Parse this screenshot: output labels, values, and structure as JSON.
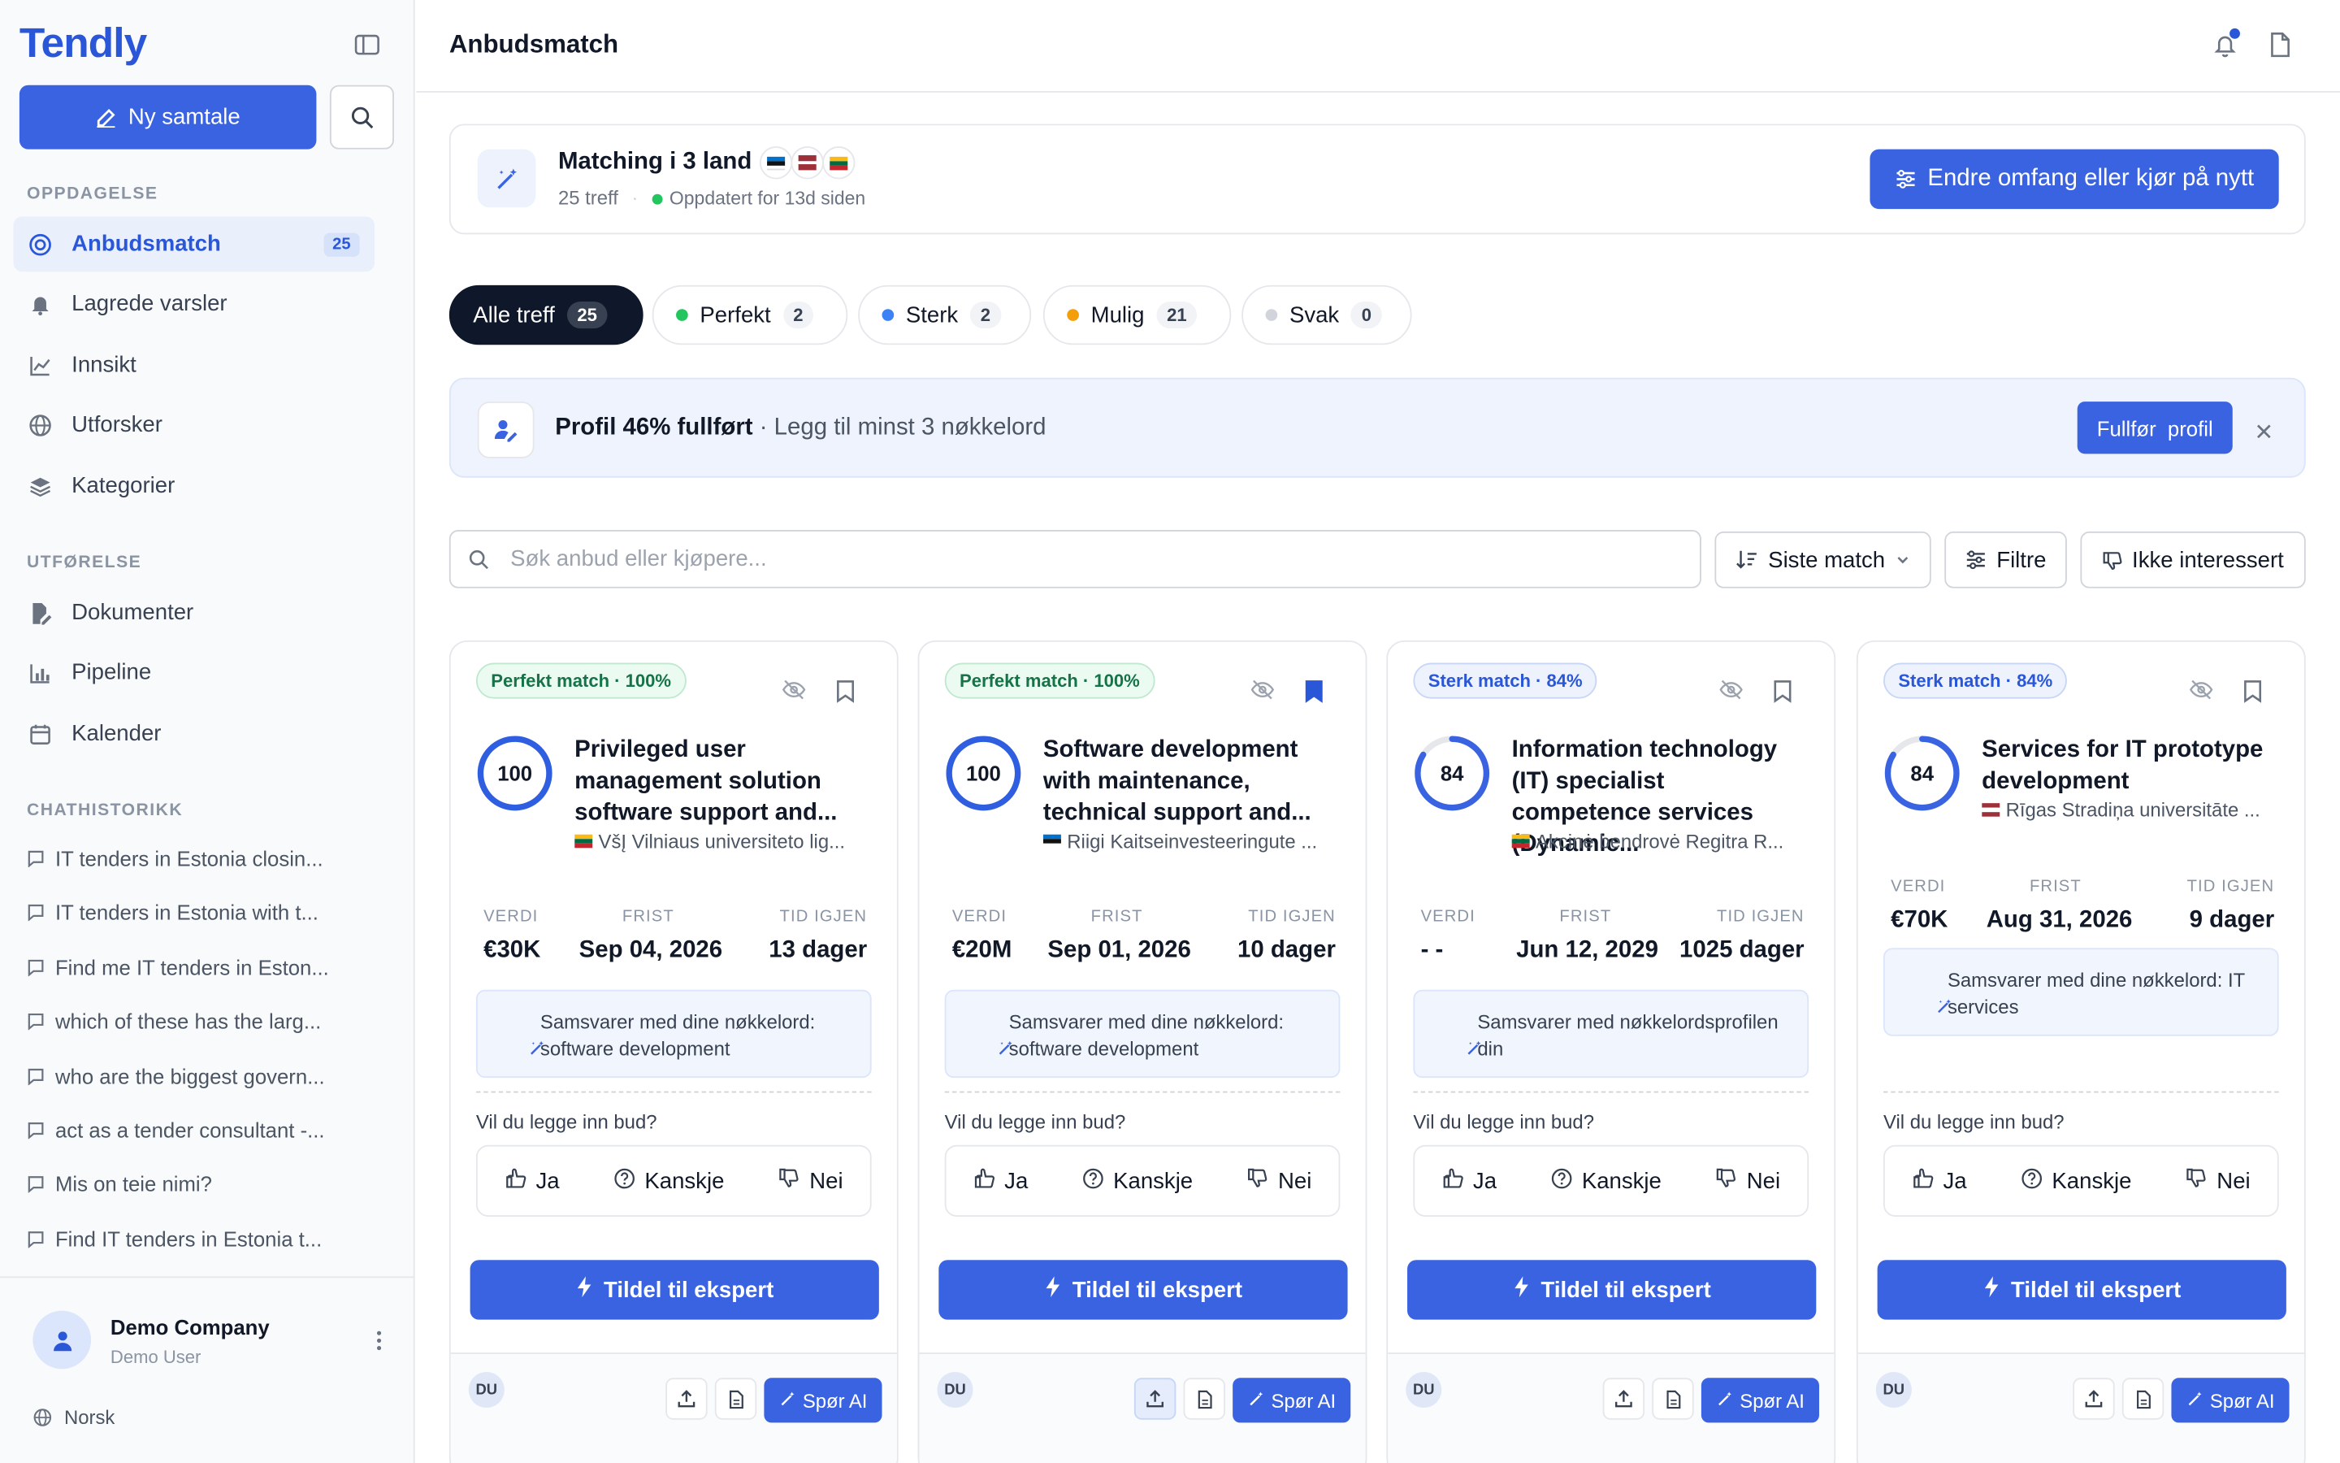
{
  "app": {
    "logo": "Tendly",
    "new_chat": "Ny samtale"
  },
  "sidebar": {
    "sections": {
      "discovery": "OPPDAGELSE",
      "execution": "UTFØRELSE",
      "history": "CHATHISTORIKK"
    },
    "discovery": [
      {
        "label": "Anbudsmatch",
        "icon": "target-icon",
        "count": "25",
        "active": true
      },
      {
        "label": "Lagrede varsler",
        "icon": "bell-icon"
      },
      {
        "label": "Innsikt",
        "icon": "line-chart-icon"
      },
      {
        "label": "Utforsker",
        "icon": "globe-icon"
      },
      {
        "label": "Kategorier",
        "icon": "layers-icon"
      }
    ],
    "execution": [
      {
        "label": "Dokumenter",
        "icon": "document-edit-icon"
      },
      {
        "label": "Pipeline",
        "icon": "bar-chart-icon"
      },
      {
        "label": "Kalender",
        "icon": "calendar-icon"
      }
    ],
    "history": [
      "IT tenders in Estonia closin...",
      "IT tenders in Estonia with t...",
      "Find me IT tenders in Eston...",
      "which of these has the larg...",
      "who are the biggest govern...",
      "act as a tender consultant -...",
      "Mis on teie nimi?",
      "Find IT tenders in Estonia t..."
    ],
    "user": {
      "company": "Demo Company",
      "name": "Demo User"
    },
    "language": "Norsk"
  },
  "header": {
    "title": "Anbudsmatch"
  },
  "matching": {
    "title": "Matching i 3 land",
    "hits": "25 treff",
    "updated": "Oppdatert for 13d siden",
    "rerun": "Endre omfang eller kjør på nytt",
    "flags": [
      "Estonia",
      "Latvia",
      "Lithuania"
    ]
  },
  "filters": [
    {
      "label": "Alle treff",
      "count": "25",
      "dot": ""
    },
    {
      "label": "Perfekt",
      "count": "2",
      "dot": "#22c55e"
    },
    {
      "label": "Sterk",
      "count": "2",
      "dot": "#3b82f6"
    },
    {
      "label": "Mulig",
      "count": "21",
      "dot": "#f59e0b"
    },
    {
      "label": "Svak",
      "count": "0",
      "dot": "#d1d5db"
    }
  ],
  "profile": {
    "title": "Profil 46% fullført",
    "sub": " · Legg til minst 3 nøkkelord",
    "button": "Fullfør  profil"
  },
  "search": {
    "placeholder": "Søk anbud eller kjøpere...",
    "sort": "Siste match",
    "filters": "Filtre",
    "not_interested": "Ikke interessert"
  },
  "labels": {
    "value": "VERDI",
    "deadline": "FRIST",
    "time_left": "TID IGJEN",
    "question": "Vil du legge inn bud?",
    "yes": "Ja",
    "maybe": "Kanskje",
    "no": "Nei",
    "expert": "Tildel til ekspert",
    "ask_ai": "Spør AI",
    "initials": "DU"
  },
  "cards": [
    {
      "badge": "Perfekt match · 100%",
      "type": "perfekt",
      "score": 100,
      "title": "Privileged user management solution software support and...",
      "buyer": "VšĮ Vilniaus universiteto lig...",
      "flag": "lt",
      "value": "€30K",
      "deadline": "Sep 04, 2026",
      "left": "13 dager",
      "kw": "Samsvarer med dine nøkkelord: software development",
      "bookmarked": false
    },
    {
      "badge": "Perfekt match · 100%",
      "type": "perfekt",
      "score": 100,
      "title": "Software development with maintenance, technical support and...",
      "buyer": "Riigi Kaitseinvesteeringute ...",
      "flag": "ee",
      "value": "€20M",
      "deadline": "Sep 01, 2026",
      "left": "10 dager",
      "kw": "Samsvarer med dine nøkkelord: software development",
      "bookmarked": true
    },
    {
      "badge": "Sterk match · 84%",
      "type": "sterk",
      "score": 84,
      "title": "Information technology (IT) specialist competence services (Dynamic...",
      "buyer": "Akcinė bendrovė Regitra  R...",
      "flag": "lt",
      "value": "- -",
      "deadline": "Jun 12, 2029",
      "left": "1025 dager",
      "kw": "Samsvarer med nøkkelordsprofilen din",
      "bookmarked": false
    },
    {
      "badge": "Sterk match · 84%",
      "type": "sterk",
      "score": 84,
      "title": "Services for IT prototype development",
      "buyer": "Rīgas Stradiņa universitāte ...",
      "flag": "lv",
      "value": "€70K",
      "deadline": "Aug 31, 2026",
      "left": "9 dager",
      "kw": "Samsvarer med dine nøkkelord: IT services",
      "bookmarked": false
    }
  ]
}
